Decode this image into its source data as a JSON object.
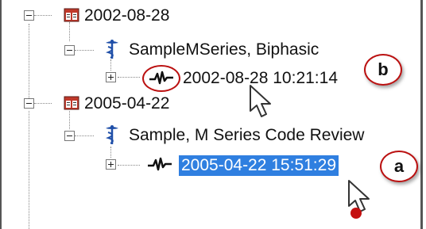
{
  "tree": {
    "dates": [
      {
        "label": "2002-08-28",
        "patient": "SampleMSeries, Biphasic",
        "record": "2002-08-28 10:21:14"
      },
      {
        "label": "2005-04-22",
        "patient": "Sample, M Series Code Review",
        "record": "2005-04-22 15:51:29"
      }
    ]
  },
  "callouts": {
    "a": "a",
    "b": "b"
  },
  "colors": {
    "selection": "#2f7fe0",
    "callout_ring": "#b11111",
    "pointer_dot": "#c41010"
  },
  "icons": [
    "calendar-icon",
    "caduceus-icon",
    "waveform-icon",
    "mouse-pointer-icon"
  ]
}
